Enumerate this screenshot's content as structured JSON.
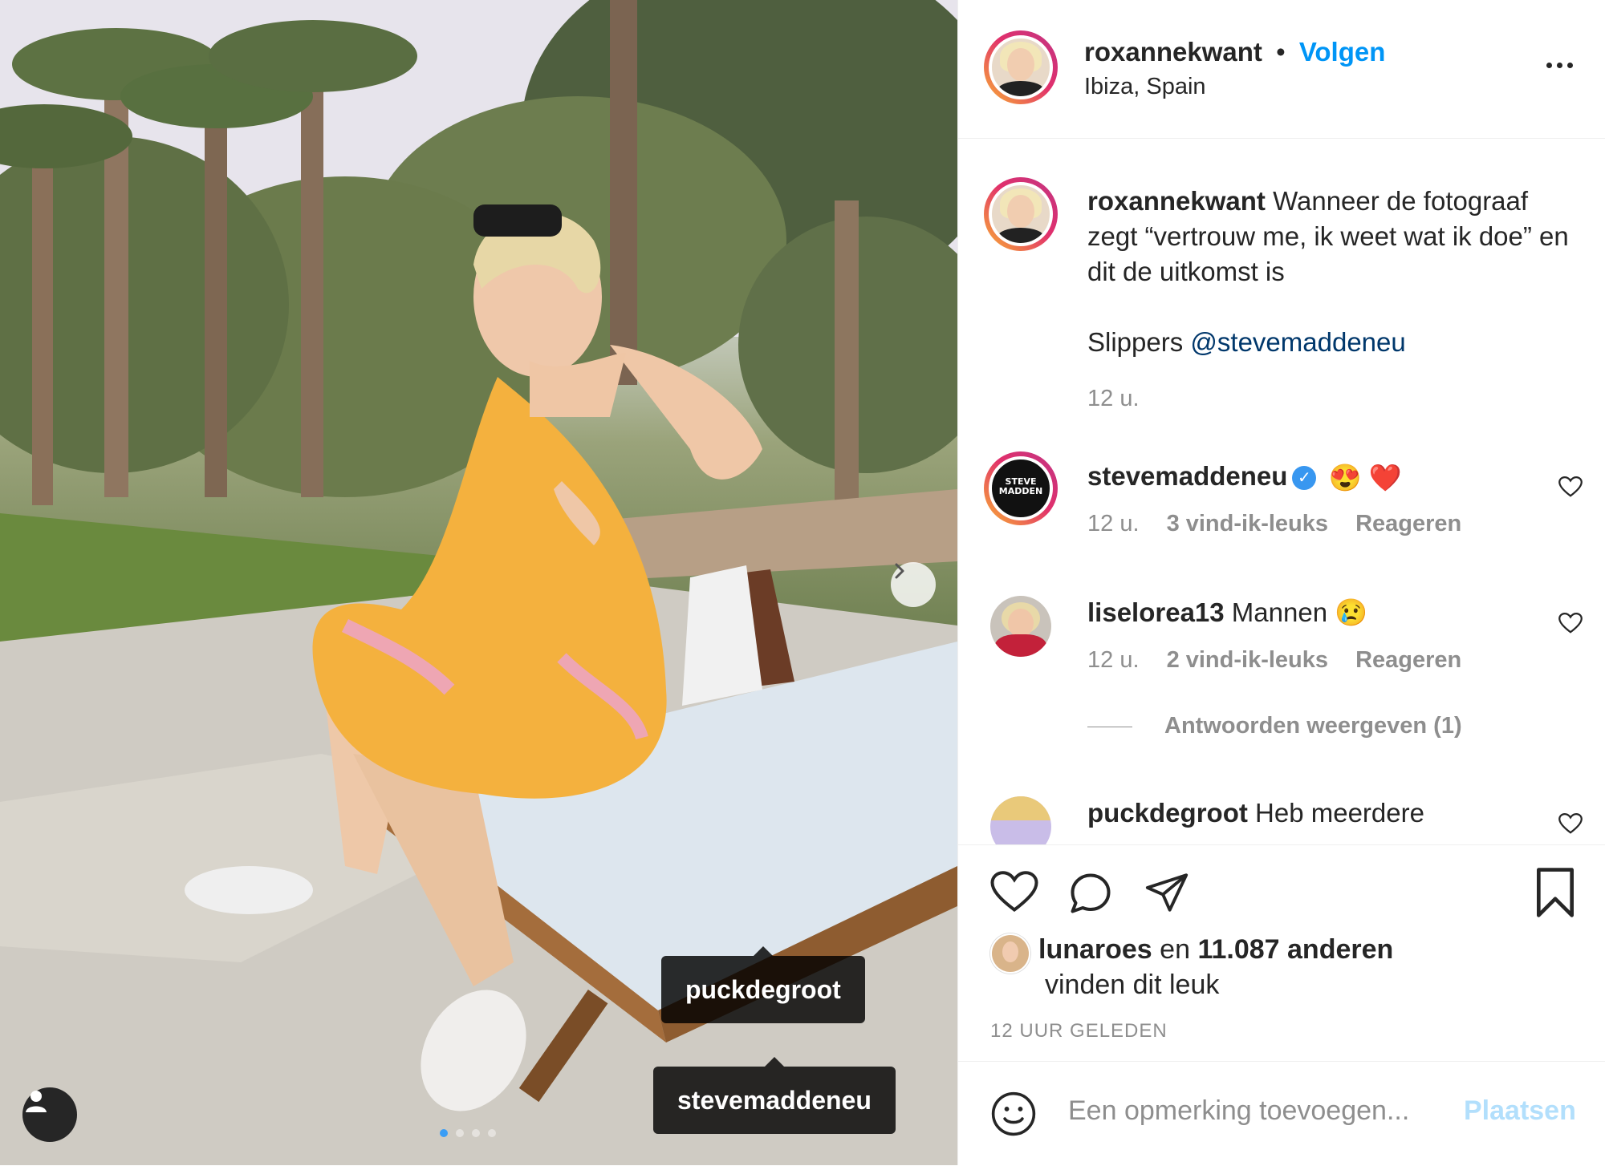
{
  "post": {
    "author": "roxannekwant",
    "follow_label": "Volgen",
    "separator": "•",
    "location": "Ibiza, Spain",
    "photo_tags": [
      "puckdegroot",
      "stevemaddeneu"
    ],
    "carousel_count": 4,
    "carousel_index": 1
  },
  "caption": {
    "author": "roxannekwant",
    "text": "Wanneer de fotograaf zegt “vertrouw me, ik weet wat ik doe” en dit de uitkomst is",
    "slippers_label": "Slippers",
    "mention": "@stevemaddeneu",
    "time": "12 u."
  },
  "comments": [
    {
      "user": "stevemaddeneu",
      "verified": true,
      "text": "😍 ❤️",
      "time": "12 u.",
      "likes": "3 vind-ik-leuks",
      "reply": "Reageren",
      "avatar_text": "STEVE MADDEN"
    },
    {
      "user": "liselorea13",
      "verified": false,
      "text": "Mannen 😢",
      "time": "12 u.",
      "likes": "2 vind-ik-leuks",
      "reply": "Reageren"
    },
    {
      "user": "puckdegroot",
      "verified": false,
      "text": "Heb meerdere"
    }
  ],
  "view_replies": "Antwoorden weergeven (1)",
  "likes": {
    "user": "lunaroes",
    "connector": "en",
    "others": "11.087 anderen",
    "suffix": "vinden dit leuk"
  },
  "timestamp": "12 UUR GELEDEN",
  "composer": {
    "placeholder": "Een opmerking toevoegen...",
    "post_label": "Plaatsen"
  },
  "colors": {
    "link_blue": "#0095f6",
    "mention_blue": "#00376b",
    "muted": "#8e8e8e",
    "dress": "#f4b13e",
    "verified": "#3897f0"
  }
}
